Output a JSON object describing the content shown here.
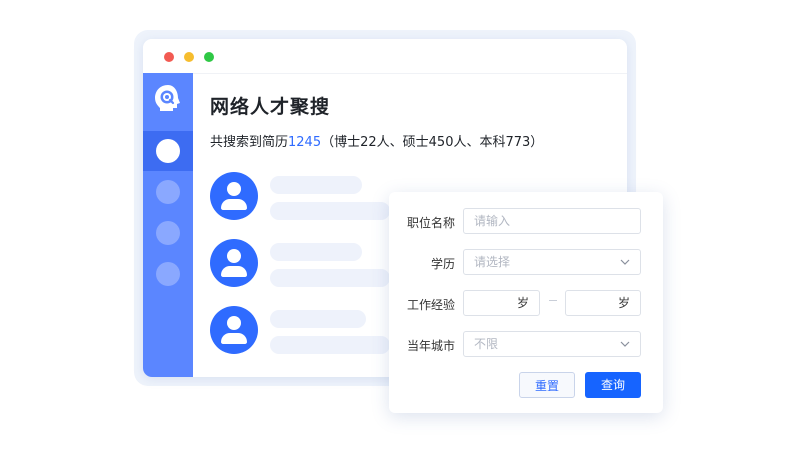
{
  "window": {
    "controls": [
      "close",
      "minimize",
      "maximize"
    ],
    "title": "网络人才聚搜",
    "summary": {
      "prefix": "共搜索到简历",
      "count": "1245",
      "suffix": "（博士22人、硕士450人、本科773）"
    }
  },
  "sidebar": {
    "logo_icon": "head-search-icon",
    "items": [
      "item-1",
      "item-2",
      "item-3",
      "item-4"
    ],
    "active_index": 0
  },
  "results": [
    {
      "avatar_icon": "user-icon"
    },
    {
      "avatar_icon": "user-icon"
    },
    {
      "avatar_icon": "user-icon"
    }
  ],
  "search_form": {
    "position_label": "职位名称",
    "position_placeholder": "请输入",
    "education_label": "学历",
    "education_placeholder": "请选择",
    "experience_label": "工作经验",
    "experience_min_unit": "岁",
    "experience_max_unit": "岁",
    "city_label": "当年城市",
    "city_value": "不限",
    "reset_label": "重置",
    "query_label": "查询"
  },
  "colors": {
    "accent": "#2f6bff",
    "sidebar": "#5b86ff",
    "sidebar_active": "#3d6cf2",
    "button_primary": "#1664ff"
  }
}
